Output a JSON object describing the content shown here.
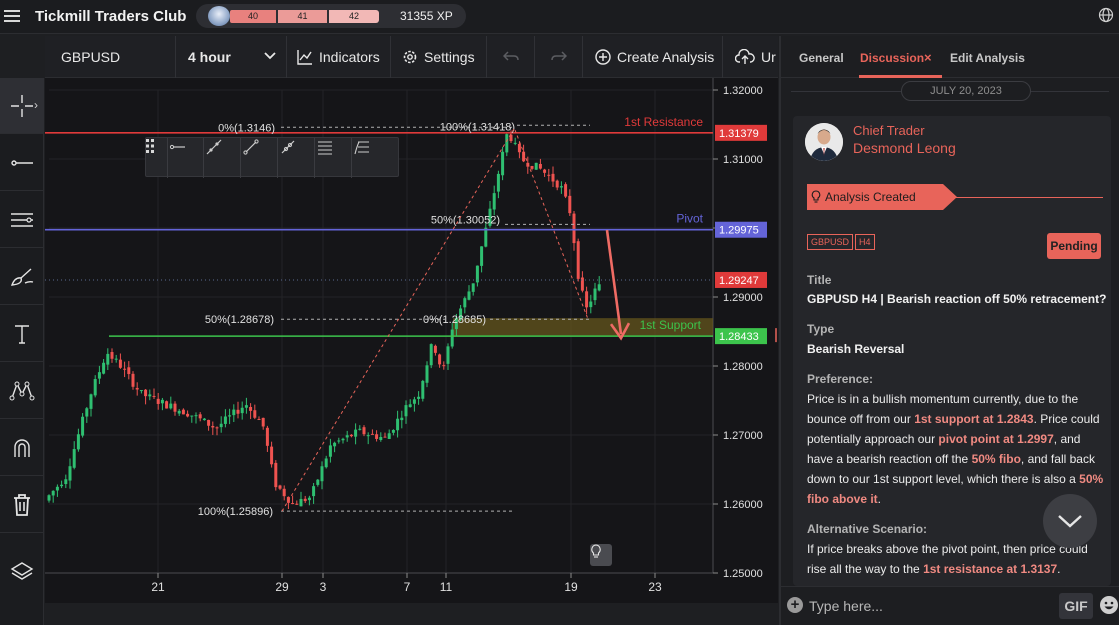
{
  "app": {
    "title": "Tickmill Traders Club",
    "levels": [
      "40",
      "41",
      "42"
    ],
    "xp": "31355 XP"
  },
  "toolbar": {
    "symbol": "GBPUSD",
    "interval": "4 hour",
    "indicators_label": "Indicators",
    "settings_label": "Settings",
    "create_analysis_label": "Create Analysis",
    "upload_label": "Ur"
  },
  "left_tools": [
    "crosshair-icon",
    "horizontal-line-icon",
    "multi-line-icon",
    "brush-icon",
    "text-icon",
    "pattern-icon",
    "magnet-icon",
    "trash-icon",
    "layers-icon"
  ],
  "chart_data": {
    "type": "candlestick",
    "symbol": "GBPUSD",
    "interval": "4 hour",
    "y_range": [
      1.25,
      1.32
    ],
    "y_ticks": [
      "1.32000",
      "1.31000",
      "1.30000",
      "1.29000",
      "1.28000",
      "1.27000",
      "1.26000",
      "1.25000"
    ],
    "x_ticks": [
      "21",
      "29",
      "3",
      "7",
      "11",
      "19",
      "23"
    ],
    "price_levels": [
      {
        "label": "1st Resistance",
        "value": 1.31379,
        "tag": "1.31379",
        "color": "#e03a3a"
      },
      {
        "label": "Pivot",
        "value": 1.29975,
        "tag": "1.29975",
        "color": "#6464d8"
      },
      {
        "label": "1st Support",
        "value": 1.28433,
        "tag": "1.28433",
        "color": "#3cc44c"
      }
    ],
    "current_price": {
      "value": 1.29247,
      "tag": "1.29247"
    },
    "fib_labels": [
      "0%(1.3146)",
      "100%(1.31418)",
      "50%(1.30052)",
      "50%(1.28678)",
      "0%(1.28685)",
      "100%(1.25896)"
    ]
  },
  "panel": {
    "tabs": [
      "General",
      "Discussion",
      "Edit Analysis"
    ],
    "active_tab": "Discussion",
    "date": "JULY 20, 2023",
    "post": {
      "role": "Chief Trader",
      "author": "Desmond Leong",
      "banner": "Analysis Created",
      "tags": [
        "GBPUSD",
        "H4"
      ],
      "status": "Pending",
      "title_label": "Title",
      "title": "GBPUSD H4 | Bearish reaction off 50% retracement?",
      "type_label": "Type",
      "type": "Bearish Reversal",
      "preference_label": "Preference:",
      "preference_parts": [
        "Price is in a bullish momentum currently, due to the bounce off from our ",
        "1st support at 1.2843",
        ". Price could potentially approach our ",
        "pivot point at 1.2997",
        ", and have a bearish reaction off the ",
        "50% fibo",
        ", and fall back down to our 1st support level, which there is also a ",
        "50% fibo above it",
        "."
      ],
      "alt_label": "Alternative Scenario:",
      "alt_parts": [
        "If price breaks above the pivot point, then price could rise all the way to the ",
        "1st resistance at 1.3137",
        "."
      ]
    },
    "input_placeholder": "Type here...",
    "gif_label": "GIF"
  }
}
